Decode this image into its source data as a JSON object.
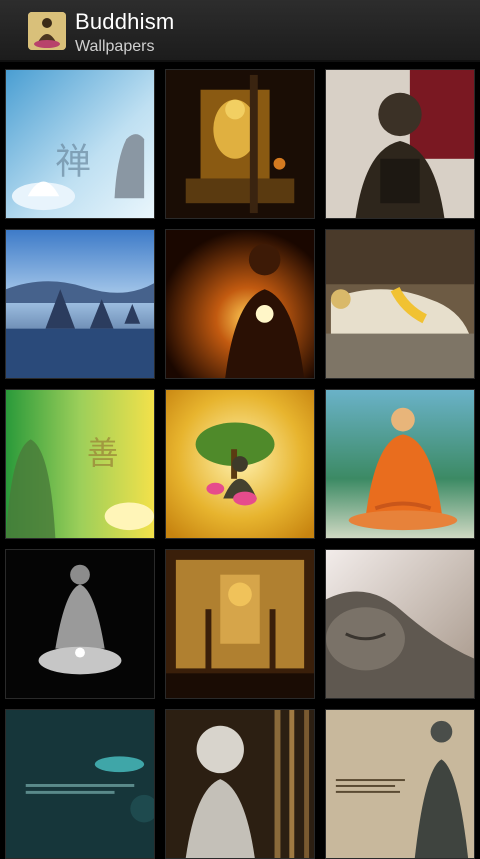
{
  "app": {
    "title": "Buddhism",
    "subtitle": "Wallpapers",
    "icon": "buddha-app-icon"
  },
  "wallpapers": [
    {
      "name": "wallpaper-blue-lotus-zen",
      "chars": "禅"
    },
    {
      "name": "wallpaper-golden-temple-shrine"
    },
    {
      "name": "wallpaper-bronze-buddha-red"
    },
    {
      "name": "wallpaper-stupas-misty-dawn"
    },
    {
      "name": "wallpaper-candle-buddha-dark"
    },
    {
      "name": "wallpaper-reclining-buddha-garland"
    },
    {
      "name": "wallpaper-green-yellow-zen",
      "chars": "善"
    },
    {
      "name": "wallpaper-buddha-tree-lotus"
    },
    {
      "name": "wallpaper-orange-robed-buddha"
    },
    {
      "name": "wallpaper-silver-buddha-black"
    },
    {
      "name": "wallpaper-golden-temple-interior"
    },
    {
      "name": "wallpaper-reclining-buddha-head"
    },
    {
      "name": "wallpaper-teal-lotus-text"
    },
    {
      "name": "wallpaper-stone-buddha-bamboo"
    },
    {
      "name": "wallpaper-statue-beige-text"
    }
  ]
}
